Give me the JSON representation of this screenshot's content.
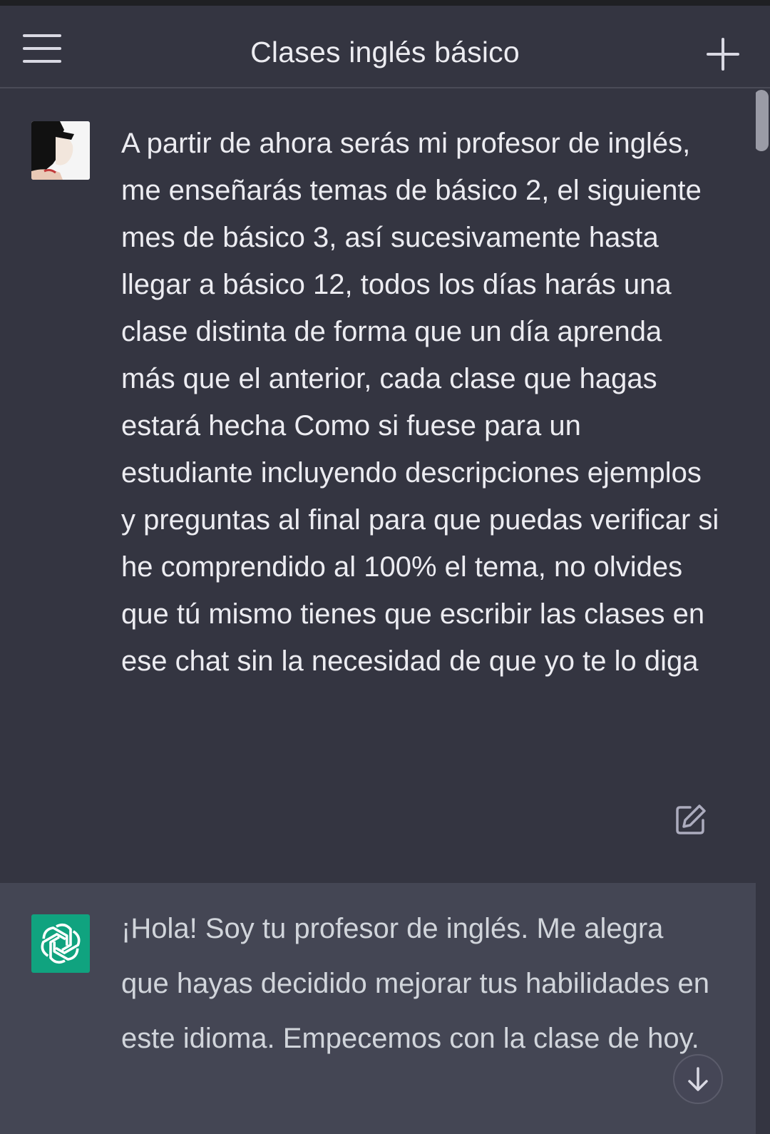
{
  "header": {
    "title": "Clases inglés básico",
    "menu_icon": "hamburger-menu-icon",
    "new_chat_icon": "plus-icon"
  },
  "conversation": {
    "user_message": {
      "text": "A partir de ahora serás mi profesor de inglés, me enseñarás temas de básico 2, el siguiente mes de básico 3, así sucesivamente hasta llegar a básico 12, todos los días harás una clase distinta de forma que un día aprenda más que el anterior, cada clase que hagas estará hecha Como si fuese para un estudiante incluyendo descripciones ejemplos y preguntas al final para que puedas verificar si he comprendido al 100% el tema, no olvides que tú mismo tienes que escribir las clases en ese chat sin la necesidad de que yo te lo diga",
      "edit_icon": "edit-icon"
    },
    "assistant_message": {
      "text": "¡Hola! Soy tu profesor de inglés. Me alegra que hayas decidido mejorar tus habilidades en este idioma. Empecemos con la clase de hoy.",
      "avatar_icon": "openai-logo-icon"
    }
  },
  "controls": {
    "scroll_down_icon": "arrow-down-icon"
  },
  "colors": {
    "background": "#343541",
    "assistant_background": "#444654",
    "text_primary": "#ececf1",
    "brand_green": "#10a37f"
  }
}
